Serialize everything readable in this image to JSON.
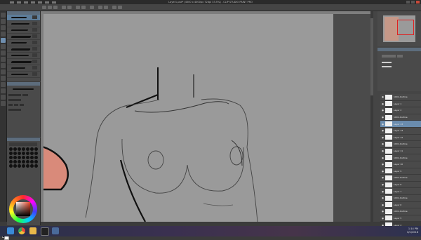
{
  "window": {
    "title": "Layer1.psd* (4500 x 4000px 72dpi 33.5%)  - CLIP STUDIO PAINT PRO"
  },
  "canvas_view": {
    "subject": "pencil sketch"
  },
  "layers": {
    "rows": [
      "1001-Outline",
      "Layer 1",
      "Layer 2",
      "1001-Outline",
      "Layer 13",
      "Layer 14",
      "Layer 12",
      "1001-Outline",
      "Layer 11",
      "1001-Outline",
      "Layer 10",
      "Layer 9",
      "1001-Outline",
      "Layer 8",
      "Layer 7",
      "1001-Outline",
      "Layer 6",
      "1001-Outline",
      "Layer 5",
      "Layer 4"
    ]
  },
  "taskbar": {
    "time": "1:14 PM",
    "date": "6/1/2018"
  },
  "colors": {
    "ui_dark": "#3b3b3b",
    "canvas": "#9a9a9a",
    "selection": "#6a8cae",
    "skin": "#d98a7a"
  },
  "icons": [
    "windows-start-icon",
    "chrome-icon",
    "folder-icon",
    "clip-studio-icon",
    "search-icon"
  ]
}
